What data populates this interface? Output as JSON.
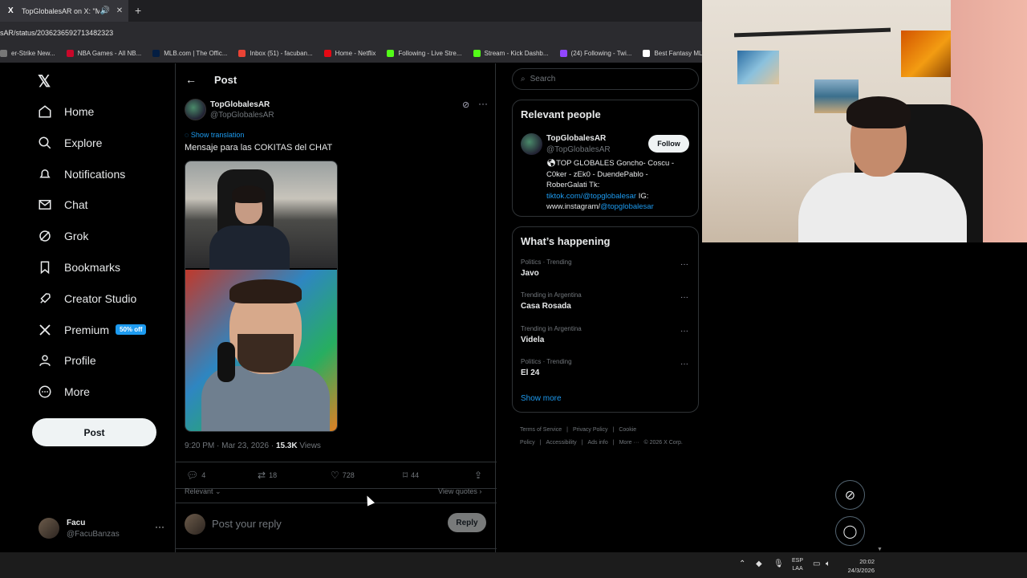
{
  "browser": {
    "tab_title": "TopGlobalesAR on X: \"Men",
    "url": "sAR/status/2036236592713482323",
    "bookmarks": [
      {
        "label": "er-Strike New...",
        "color": "#777"
      },
      {
        "label": "NBA Games - All NB...",
        "color": "#c9082a"
      },
      {
        "label": "MLB.com | The Offic...",
        "color": "#041e42"
      },
      {
        "label": "Inbox (51) - facuban...",
        "color": "#ea4335"
      },
      {
        "label": "Home - Netflix",
        "color": "#e50914"
      },
      {
        "label": "Following - Live Stre...",
        "color": "#53fc18"
      },
      {
        "label": "Stream - Kick Dashb...",
        "color": "#53fc18"
      },
      {
        "label": "(24) Following - Twi...",
        "color": "#9146ff"
      },
      {
        "label": "Best Fantasy MLB -...",
        "color": "#ffffff"
      }
    ]
  },
  "nav": {
    "items": [
      {
        "label": "Home",
        "icon": "home-icon"
      },
      {
        "label": "Explore",
        "icon": "search-icon"
      },
      {
        "label": "Notifications",
        "icon": "bell-icon"
      },
      {
        "label": "Chat",
        "icon": "mail-icon"
      },
      {
        "label": "Grok",
        "icon": "grok-icon"
      },
      {
        "label": "Bookmarks",
        "icon": "bookmark-icon"
      },
      {
        "label": "Creator Studio",
        "icon": "rocket-icon"
      },
      {
        "label": "Premium",
        "icon": "x-icon",
        "badge": "50% off"
      },
      {
        "label": "Profile",
        "icon": "person-icon"
      },
      {
        "label": "More",
        "icon": "more-circle-icon"
      }
    ],
    "post_label": "Post",
    "user": {
      "name": "Facu",
      "handle": "@FacuBanzas"
    }
  },
  "post": {
    "header_title": "Post",
    "author_name": "TopGlobalesAR",
    "author_handle": "@TopGlobalesAR",
    "show_translation": "Show translation",
    "text": "Mensaje para las COKITAS del CHAT",
    "time": "9:20 PM · Mar 23, 2026 · ",
    "views_count": "15.3K",
    "views_label": " Views",
    "stats": {
      "replies": "4",
      "reposts": "18",
      "likes": "728",
      "bookmarks": "44"
    },
    "relevant": "Relevant",
    "view_quotes": "View quotes",
    "reply_placeholder": "Post your reply",
    "reply_button": "Reply"
  },
  "right": {
    "search_placeholder": "Search",
    "relevant_people_title": "Relevant people",
    "person": {
      "name": "TopGlobalesAR",
      "handle": "@TopGlobalesAR",
      "follow": "Follow",
      "bio_text": "TOP GLOBALES Goncho- Coscu - C0ker - zEk0 - DuendePablo - RoberGalati Tk: ",
      "bio_link1": "tiktok.com/@topglobalesar",
      "bio_mid": " IG: www.instagram/",
      "bio_link2": "@topglobalesar"
    },
    "happening_title": "What’s happening",
    "trends": [
      {
        "context": "Politics · Trending",
        "name": "Javo"
      },
      {
        "context": "Trending in Argentina",
        "name": "Casa Rosada"
      },
      {
        "context": "Trending in Argentina",
        "name": "Videla"
      },
      {
        "context": "Politics · Trending",
        "name": "El 24"
      }
    ],
    "show_more": "Show more",
    "footer": [
      "Terms of Service",
      "|",
      "Privacy Policy",
      "|",
      "Cookie Policy",
      "|",
      "Accessibility",
      "|",
      "Ads info",
      "|",
      "More ···",
      "© 2026 X Corp."
    ]
  },
  "taskbar": {
    "lang1": "ESP",
    "lang2": "LAA",
    "time": "20:02",
    "date": "24/3/2026"
  }
}
